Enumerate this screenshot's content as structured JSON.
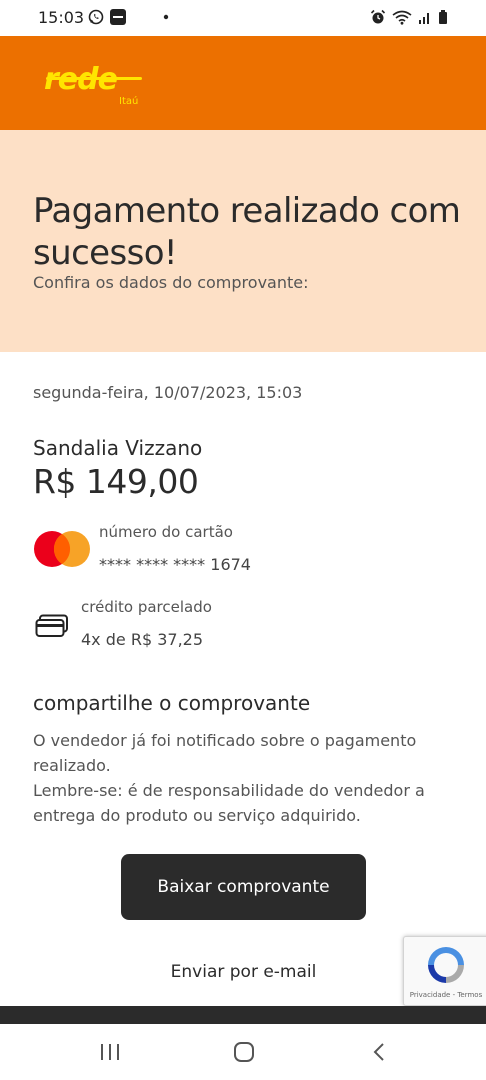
{
  "status_bar": {
    "time": "15:03"
  },
  "header": {
    "logo_text": "rede",
    "logo_sub": "Itaú"
  },
  "hero": {
    "title": "Pagamento realizado com sucesso!",
    "subtitle": "Confira os dados do comprovante:"
  },
  "receipt": {
    "date": "segunda-feira, 10/07/2023, 15:03",
    "merchant": "Sandalia Vizzano",
    "amount": "R$ 149,00",
    "card_label": "número do cartão",
    "card_number": "**** **** **** 1674",
    "payment_label": "crédito parcelado",
    "payment_value": "4x de R$ 37,25"
  },
  "share": {
    "title": "compartilhe o comprovante",
    "text": "O vendedor já foi notificado sobre o pagamento realizado.\nLembre-se: é de responsabilidade do vendedor a entrega do produto ou serviço adquirido."
  },
  "actions": {
    "download_label": "Baixar comprovante",
    "email_label": "Enviar por e-mail"
  },
  "recaptcha": {
    "links": "Privacidade - Termos"
  },
  "colors": {
    "brand": "#ec7000",
    "hero_bg": "#fde0c6",
    "logo": "#ffe500",
    "button": "#2b2b2b"
  }
}
